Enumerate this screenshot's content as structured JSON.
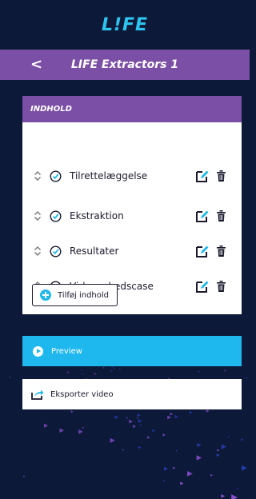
{
  "app": {
    "logo": "L!FE",
    "title": "LIFE Extractors 1",
    "back_glyph": "<"
  },
  "panel": {
    "header": "INDHOLD",
    "items": [
      {
        "label": "Tilrettelæggelse",
        "checked": true
      },
      {
        "label": "Ekstraktion",
        "checked": true
      },
      {
        "label": "Resultater",
        "checked": true
      },
      {
        "label": "Virksomhedscase",
        "checked": false
      }
    ],
    "add_label": "Tilføj indhold"
  },
  "actions": {
    "preview_label": "Preview",
    "export_label": "Eksporter video"
  },
  "colors": {
    "background": "#0c1939",
    "purple": "#7b4fa6",
    "accent": "#1fb8ee"
  },
  "icons": {
    "sort": "sort-icon",
    "check": "check-circle-icon",
    "edit": "edit-icon",
    "trash": "trash-icon",
    "add": "plus-circle-icon",
    "preview": "play-icon",
    "export": "export-icon"
  }
}
